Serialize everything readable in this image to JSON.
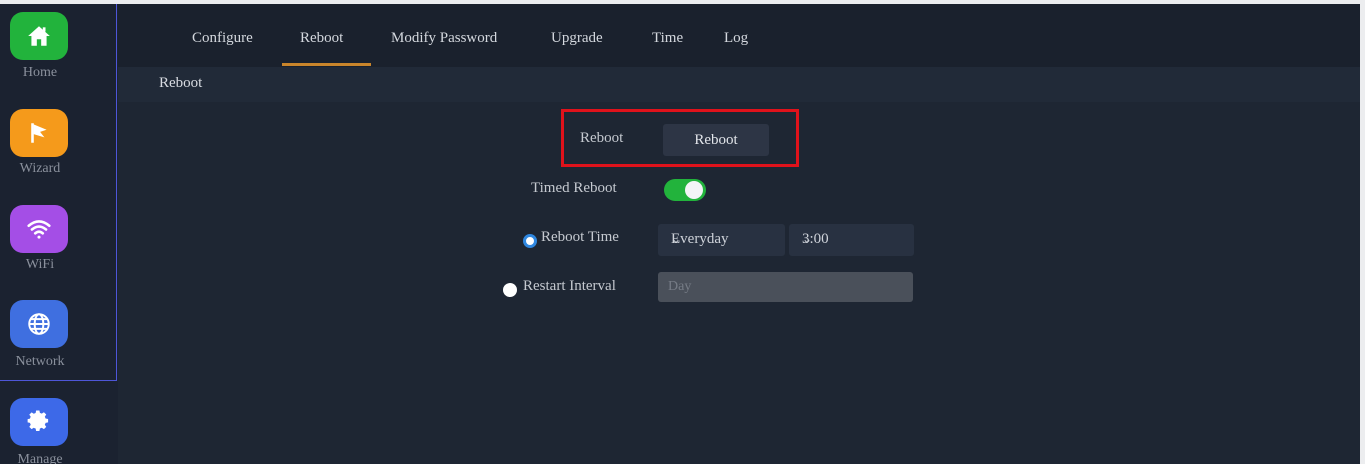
{
  "sidebar": {
    "items": [
      {
        "label": "Home",
        "icon": "home-icon",
        "color": "#22b33c"
      },
      {
        "label": "Wizard",
        "icon": "flag-icon",
        "color": "#f59a1b"
      },
      {
        "label": "WiFi",
        "icon": "wifi-icon",
        "color": "#a44ee6"
      },
      {
        "label": "Network",
        "icon": "globe-icon",
        "color": "#3f6fe0"
      },
      {
        "label": "Manage",
        "icon": "gear-icon",
        "color": "#3d69e8"
      }
    ]
  },
  "tabs": [
    {
      "label": "Configure"
    },
    {
      "label": "Reboot",
      "active": true
    },
    {
      "label": "Modify Password"
    },
    {
      "label": "Upgrade"
    },
    {
      "label": "Time"
    },
    {
      "label": "Log"
    }
  ],
  "section_title": "Reboot",
  "form": {
    "reboot_label": "Reboot",
    "reboot_button": "Reboot",
    "timed_reboot_label": "Timed Reboot",
    "timed_reboot_enabled": true,
    "reboot_time_label": "Reboot Time",
    "reboot_time_selected": true,
    "day_select_value": "Everyday",
    "time_select_value": "3:00",
    "restart_interval_label": "Restart Interval",
    "restart_interval_selected": false,
    "restart_interval_placeholder": "Day"
  },
  "colors": {
    "accent": "#c9852b",
    "toggle_on": "#22b33c",
    "highlight": "#e0121b",
    "radio_on": "#2f87e0"
  }
}
